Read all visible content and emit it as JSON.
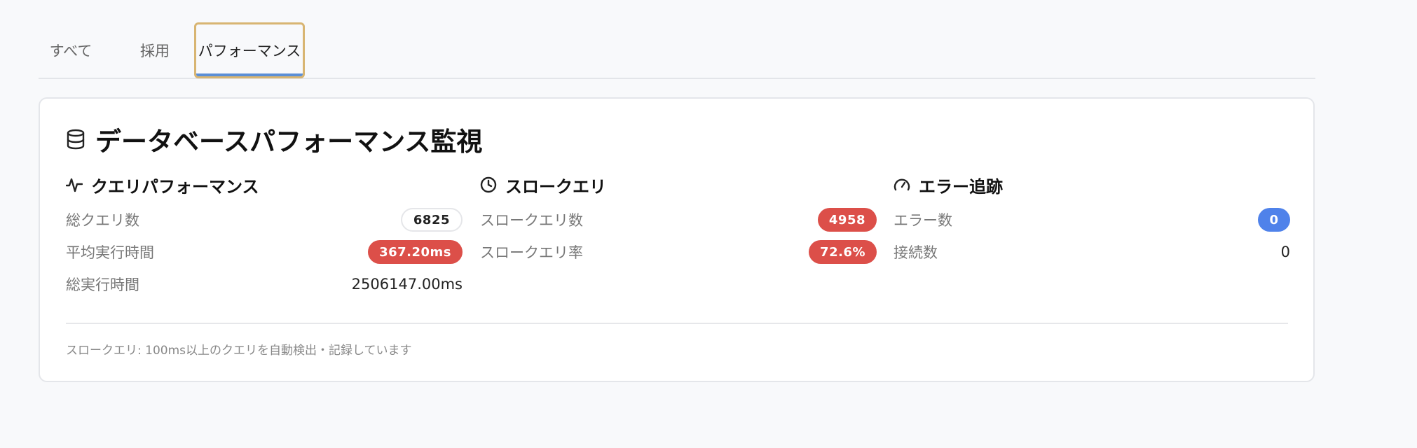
{
  "tabs": [
    {
      "label": "すべて"
    },
    {
      "label": "採用"
    },
    {
      "label": "パフォーマンス"
    }
  ],
  "card": {
    "title": "データベースパフォーマンス監視",
    "title_icon": "database-icon",
    "columns": [
      {
        "heading": "クエリパフォーマンス",
        "icon": "activity-icon",
        "rows": [
          {
            "label": "総クエリ数",
            "value": "6825",
            "style": "outline"
          },
          {
            "label": "平均実行時間",
            "value": "367.20ms",
            "style": "red"
          },
          {
            "label": "総実行時間",
            "value": "2506147.00ms",
            "style": "plain"
          }
        ]
      },
      {
        "heading": "スロークエリ",
        "icon": "clock-icon",
        "rows": [
          {
            "label": "スロークエリ数",
            "value": "4958",
            "style": "red"
          },
          {
            "label": "スロークエリ率",
            "value": "72.6%",
            "style": "red"
          }
        ]
      },
      {
        "heading": "エラー追跡",
        "icon": "gauge-icon",
        "rows": [
          {
            "label": "エラー数",
            "value": "0",
            "style": "blue"
          },
          {
            "label": "接続数",
            "value": "0",
            "style": "plain"
          }
        ]
      }
    ],
    "footer": "スロークエリ: 100ms以上のクエリを自動検出・記録しています"
  },
  "colors": {
    "accent_blue": "#4f82ea",
    "danger_red": "#dc4f49",
    "focus_outline": "#d8b572"
  }
}
